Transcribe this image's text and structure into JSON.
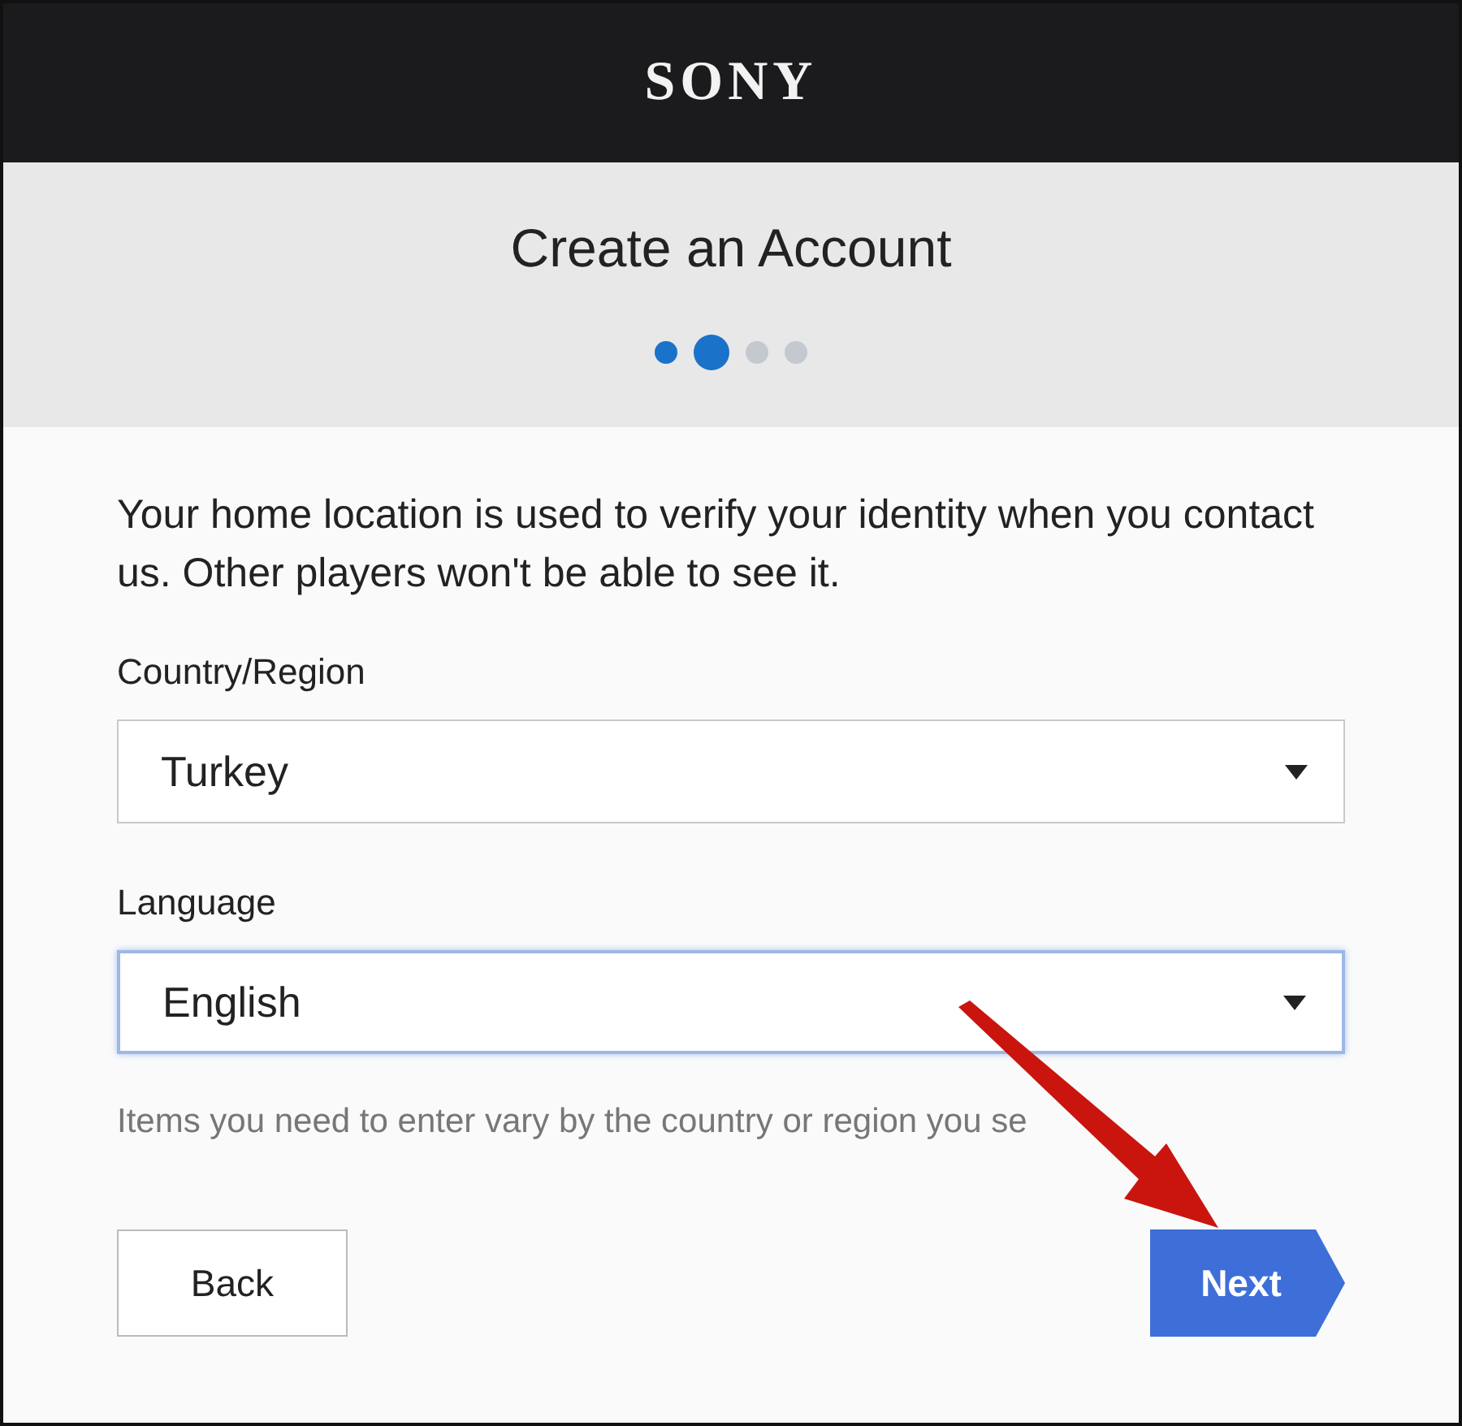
{
  "header": {
    "logo": "SONY"
  },
  "title": "Create an Account",
  "steps": [
    {
      "done": true,
      "selected": false
    },
    {
      "done": true,
      "selected": true
    },
    {
      "done": false,
      "selected": false
    },
    {
      "done": false,
      "selected": false
    }
  ],
  "intro": "Your home location is used to verify your identity when you contact us. Other players won't be able to see it.",
  "fields": [
    {
      "label": "Country/Region",
      "value": "Turkey",
      "focused": false
    },
    {
      "label": "Language",
      "value": "English",
      "focused": true
    }
  ],
  "hint": "Items you need to enter vary by the country or region you se",
  "buttons": {
    "back": "Back",
    "next": "Next"
  },
  "annotation": {
    "kind": "arrow"
  }
}
